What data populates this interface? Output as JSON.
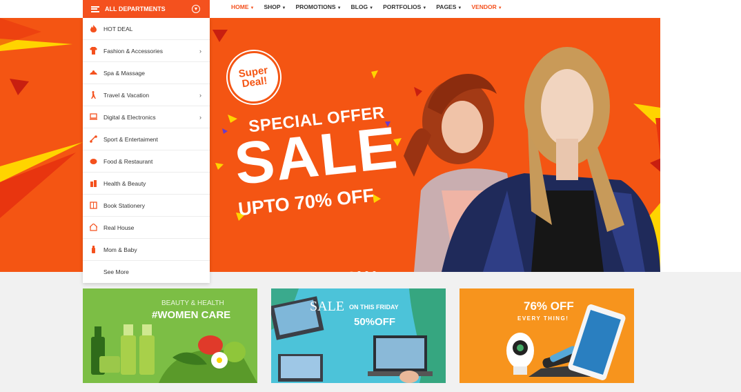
{
  "header": {
    "departments_label": "ALL DEPARTMENTS",
    "nav": [
      {
        "label": "HOME",
        "active": true
      },
      {
        "label": "SHOP"
      },
      {
        "label": "PROMOTIONS"
      },
      {
        "label": "BLOG"
      },
      {
        "label": "PORTFOLIOS"
      },
      {
        "label": "PAGES"
      },
      {
        "label": "VENDOR"
      }
    ]
  },
  "sidebar": {
    "items": [
      {
        "label": "HOT DEAL",
        "icon": "flame-icon"
      },
      {
        "label": "Fashion & Accessories",
        "icon": "shirt-icon",
        "has_sub": true
      },
      {
        "label": "Spa & Massage",
        "icon": "lotus-icon"
      },
      {
        "label": "Travel & Vacation",
        "icon": "traveler-icon",
        "has_sub": true
      },
      {
        "label": "Digital & Electronics",
        "icon": "laptop-icon",
        "has_sub": true
      },
      {
        "label": "Sport & Entertaiment",
        "icon": "dumbbell-icon"
      },
      {
        "label": "Food & Restaurant",
        "icon": "food-icon"
      },
      {
        "label": "Health & Beauty",
        "icon": "bottles-icon"
      },
      {
        "label": "Book Stationery",
        "icon": "book-icon"
      },
      {
        "label": "Real House",
        "icon": "house-icon"
      },
      {
        "label": "Mom & Baby",
        "icon": "baby-bottle-icon"
      },
      {
        "label": "See More",
        "icon": ""
      }
    ]
  },
  "hero": {
    "badge_line1": "Super",
    "badge_line2": "Deal!",
    "headline": "SPECIAL OFFER",
    "sale": "SALE",
    "discount": "UPTO 70% OFF",
    "slides": 4,
    "active_slide": 0
  },
  "promos": {
    "green": {
      "subtitle": "BEAUTY & HEALTH",
      "title": "#WOMEN CARE"
    },
    "blue": {
      "sale": "SALE",
      "on_friday": "ON THIS FRIDAY",
      "discount": "50%OFF"
    },
    "orange": {
      "discount": "76% OFF",
      "subtitle": "EVERY THING!"
    }
  },
  "colors": {
    "accent": "#f4511e",
    "hero_bg": "#f45513",
    "yellow": "#ffd400",
    "green": "#7cbe45",
    "blue": "#4cc3d9",
    "orange": "#f7941d"
  }
}
